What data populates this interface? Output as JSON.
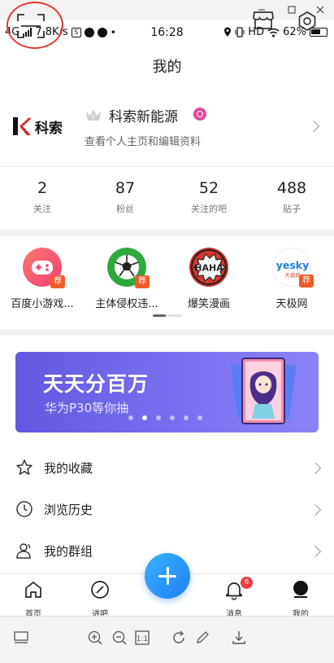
{
  "statusbar": {
    "network": "4G",
    "speed": "7.8K/s",
    "s_badge": "S",
    "time": "16:28",
    "hd": "HD",
    "battery": "62%"
  },
  "header": {
    "title": "我的"
  },
  "profile": {
    "logo_text": "科索",
    "name": "科索新能源",
    "subtitle": "查看个人主页和编辑资料"
  },
  "stats": [
    {
      "value": "2",
      "label": "关注"
    },
    {
      "value": "87",
      "label": "粉丝"
    },
    {
      "value": "52",
      "label": "关注的吧"
    },
    {
      "value": "488",
      "label": "贴子"
    }
  ],
  "apps": [
    {
      "label": "百度小游戏...",
      "badge": "荐",
      "icon": "game-controller-icon"
    },
    {
      "label": "主体侵权违...",
      "badge": "荐",
      "icon": "soccer-ball-icon"
    },
    {
      "label": "爆笑漫画",
      "icon": "haha-comic-icon",
      "logo_text": "HAHA"
    },
    {
      "label": "天极网",
      "badge": "荐",
      "icon": "yesky-logo-icon",
      "logo_text": "yesky",
      "logo_sub": "天极网"
    }
  ],
  "banner": {
    "title": "天天分百万",
    "subtitle": "华为P30等你抽",
    "active_dot": 1,
    "dot_count": 7
  },
  "menu": [
    {
      "label": "我的收藏",
      "icon": "star-icon"
    },
    {
      "label": "浏览历史",
      "icon": "clock-icon"
    },
    {
      "label": "我的群组",
      "icon": "group-icon"
    }
  ],
  "tabbar": {
    "tabs": [
      {
        "label": "首页",
        "icon": "home-icon"
      },
      {
        "label": "进吧",
        "icon": "compass-icon"
      },
      {
        "label": "消息",
        "icon": "bell-icon",
        "badge": "6"
      },
      {
        "label": "我的",
        "icon": "profile-icon"
      }
    ],
    "fab_icon": "plus-icon"
  },
  "colors": {
    "accent_blue": "#1e7ff2",
    "banner_purple": "#6458e0",
    "badge_red": "#f03c3c",
    "recommend_orange": "#f05a28",
    "gender_pink": "#e0489a",
    "highlight_circle": "#e53935"
  }
}
